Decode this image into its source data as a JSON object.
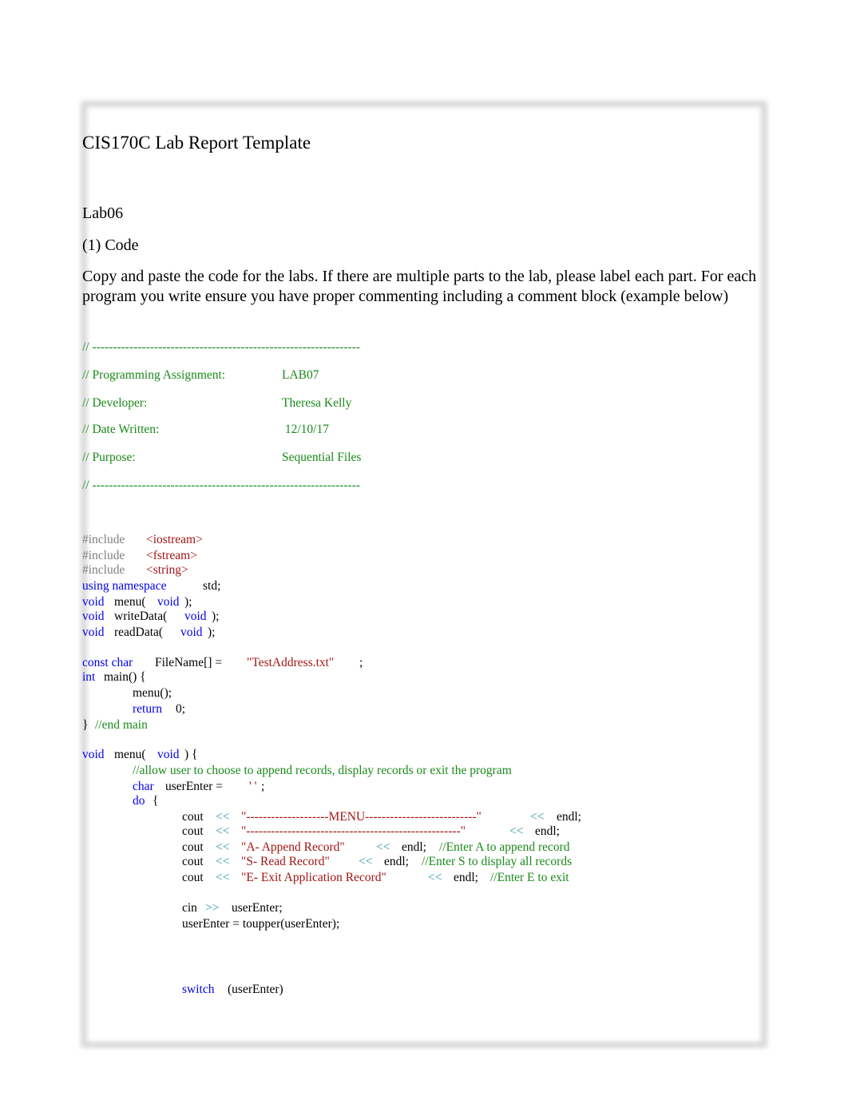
{
  "document": {
    "title": "CIS170C Lab Report Template",
    "lab_name": "Lab06",
    "section_heading": "(1) Code",
    "instructions": "Copy and paste the code for the labs. If there are multiple parts to the lab, please label each part. For each program you write ensure you have proper commenting including a comment block (example below)"
  },
  "comment_block": {
    "rule": "// -----------------------------------------------------------------",
    "fields": [
      {
        "label": "// Programming Assignment:",
        "value": "LAB07"
      },
      {
        "label": "// Developer:",
        "value": "Theresa Kelly"
      },
      {
        "label": "// Date Written:",
        "value": " 12/10/17"
      },
      {
        "label": "// Purpose:",
        "value": "Sequential Files"
      }
    ]
  },
  "code": {
    "include_kw": "#include",
    "includes": [
      "<iostream>",
      "<fstream>",
      "<string>"
    ],
    "using_kw": "using namespace",
    "using_ns": "std;",
    "void_kw": "void",
    "protos": [
      {
        "name": "menu(",
        "param": "void",
        "end": ");"
      },
      {
        "name": "writeData(",
        "param": "void",
        "end": ");"
      },
      {
        "name": "readData(",
        "param": "void",
        "end": ");"
      }
    ],
    "const_kw": "const char",
    "filename_decl": "FileName[] =",
    "filename_value": "\"TestAddress.txt\"",
    "semicolon": ";",
    "int_kw": "int",
    "main_sig": "main() {",
    "menu_call": "menu();",
    "return_kw": "return",
    "return_val": "0;",
    "close_brace": "}",
    "end_main_comment": "//end main",
    "menu_def_name": "menu(",
    "menu_def_end": ") {",
    "menu_comment": "//allow user to choose to append records, display records or exit the program",
    "char_kw": "char",
    "user_enter_decl": "userEnter =",
    "char_literal": "' '",
    "do_kw": "do",
    "open_brace": "{",
    "cout_kw": "cout",
    "shift_out": "<<",
    "endl": "endl;",
    "cout_lines": [
      {
        "str": "\"--------------------MENU---------------------------\"",
        "comment": ""
      },
      {
        "str": "\"----------------------------------------------------\"",
        "comment": ""
      },
      {
        "str": "\"A- Append Record\"",
        "comment": "//Enter A to append record"
      },
      {
        "str": "\"S- Read Record\"",
        "comment": "//Enter S to display all records"
      },
      {
        "str": "\"E- Exit Application Record\"",
        "comment": "//Enter E to exit"
      }
    ],
    "cin_kw": "cin",
    "shift_in": ">>",
    "cin_target": "userEnter;",
    "toupper_line": "userEnter = toupper(userEnter);",
    "switch_kw": "switch",
    "switch_expr": "(userEnter)"
  }
}
